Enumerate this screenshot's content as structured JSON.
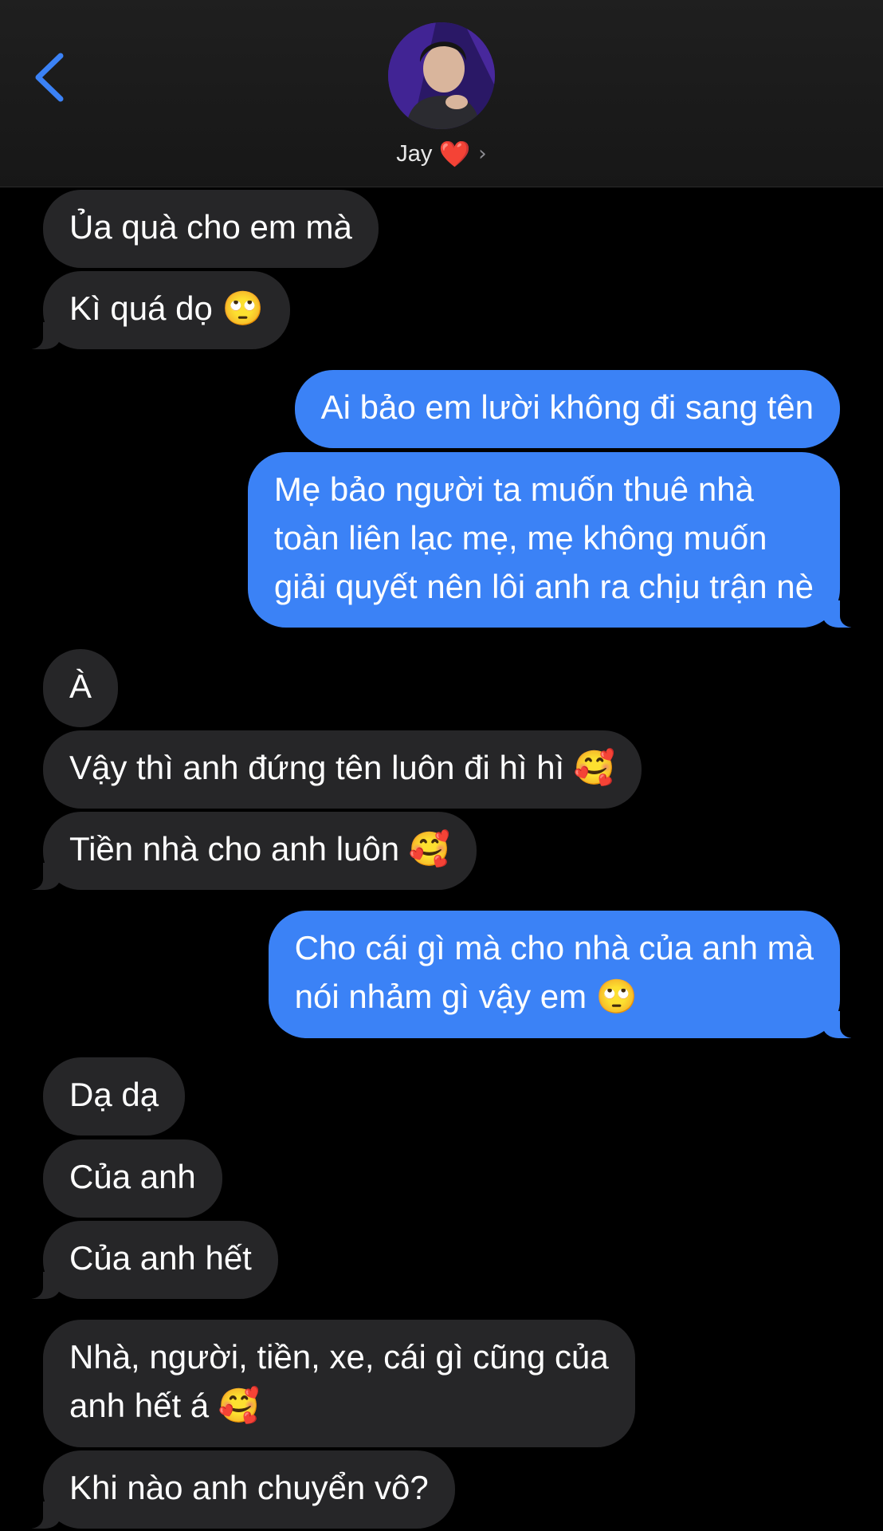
{
  "header": {
    "back_icon": "chevron-left-icon",
    "contact_name": "Jay",
    "heart_emoji": "❤️",
    "chevron": "›"
  },
  "messages": [
    {
      "side": "in",
      "text": "Ủa quà cho em mà"
    },
    {
      "side": "in",
      "text": "Kì quá dọ 🙄"
    },
    {
      "side": "out",
      "text": "Ai bảo em lười không đi sang tên"
    },
    {
      "side": "out",
      "lines": [
        "Mẹ bảo người ta muốn thuê nhà",
        "toàn liên lạc mẹ, mẹ không muốn",
        "giải quyết nên lôi anh ra chịu trận nè"
      ]
    },
    {
      "side": "in",
      "text": "À"
    },
    {
      "side": "in",
      "text": "Vậy thì anh đứng tên luôn đi hì hì 🥰"
    },
    {
      "side": "in",
      "text": "Tiền nhà cho anh luôn 🥰"
    },
    {
      "side": "out",
      "lines": [
        "Cho cái gì mà cho nhà của anh mà",
        "nói nhảm gì vậy em 🙄"
      ]
    },
    {
      "side": "in",
      "text": "Dạ dạ"
    },
    {
      "side": "in",
      "text": "Của anh"
    },
    {
      "side": "in",
      "text": "Của anh hết"
    },
    {
      "side": "in",
      "lines": [
        "Nhà, người, tiền, xe, cái gì cũng của",
        "anh hết á 🥰"
      ]
    },
    {
      "side": "in",
      "text": "Khi nào anh chuyển vô?"
    }
  ],
  "colors": {
    "incoming_bubble": "#262628",
    "outgoing_bubble": "#3b82f6",
    "accent": "#3b82f6",
    "heart": "#e0202a",
    "background": "#000000"
  }
}
